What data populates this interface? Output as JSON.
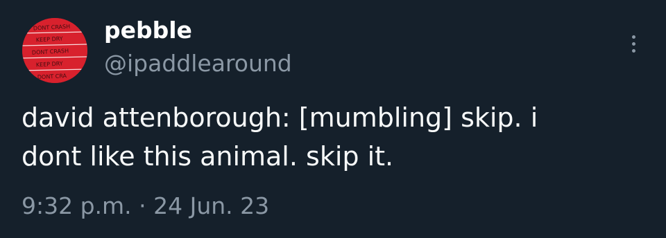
{
  "tweet": {
    "author": {
      "display_name": "pebble",
      "handle": "@ipaddlearound",
      "avatar_icon": "avatar-tape-icon",
      "avatar_text_lines": [
        "DONT CRASH",
        "KEEP DRY",
        "DONT CRASH",
        "KEEP DRY",
        "DONT CRASH"
      ]
    },
    "text": "david attenborough: [mumbling] skip. i dont like this animal. skip it.",
    "timestamp": "9:32 p.m. · 24 Jun. 23",
    "more_icon": "more-options-icon"
  },
  "colors": {
    "background": "#15202b",
    "primary_text": "#f7f9f9",
    "secondary_text": "#8b98a5",
    "avatar_red": "#d8212d"
  }
}
